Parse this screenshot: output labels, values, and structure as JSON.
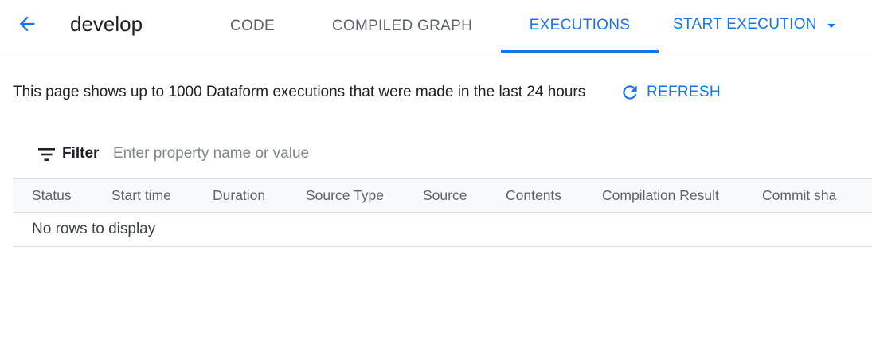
{
  "header": {
    "title": "develop",
    "tabs": [
      {
        "label": "CODE"
      },
      {
        "label": "COMPILED GRAPH"
      },
      {
        "label": "EXECUTIONS",
        "active": true
      }
    ],
    "start_execution_label": "START EXECUTION"
  },
  "info": {
    "text": "This page shows up to 1000 Dataform executions that were made in the last 24 hours",
    "refresh_label": "REFRESH"
  },
  "filter": {
    "label": "Filter",
    "placeholder": "Enter property name or value",
    "value": ""
  },
  "table": {
    "columns": [
      "Status",
      "Start time",
      "Duration",
      "Source Type",
      "Source",
      "Contents",
      "Compilation Result",
      "Commit sha"
    ],
    "rows": [],
    "empty_message": "No rows to display"
  },
  "colors": {
    "accent": "#1a73e8",
    "text": "#202124",
    "muted": "#5f6368",
    "border": "#dadce0",
    "header_bg": "#f8f9fa"
  },
  "icons": {
    "back": "arrow-back-icon",
    "dropdown": "caret-down-icon",
    "refresh": "refresh-icon",
    "filter": "filter-list-icon"
  }
}
